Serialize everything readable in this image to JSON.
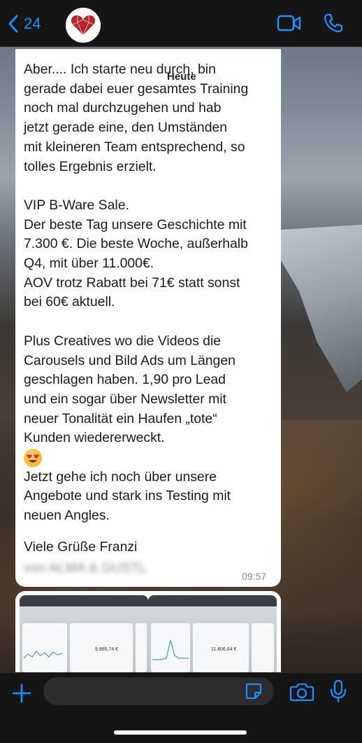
{
  "header": {
    "back_count": "24",
    "icons": {
      "back": "chevron-left-icon",
      "video": "video-camera-icon",
      "phone": "phone-icon",
      "avatar": "heart-logo-avatar"
    },
    "accent": "#1f8fff"
  },
  "date_chip": "Heute",
  "message": {
    "text": "Aber.... Ich starte neu durch, bin\ngerade dabei euer gesamtes Training\nnoch mal durchzugehen und hab\njetzt gerade eine, den Umständen\nmit kleineren Team entsprechend, so\ntolles Ergebnis erzielt.\n\nVIP B-Ware Sale.\nDer beste Tag unsere Geschichte mit\n7.300 €. Die beste Woche, außerhalb\nQ4, mit über 11.000€.\nAOV trotz Rabatt bei 71€ statt sonst\nbei 60€ aktuell.\n\nPlus Creatives wo die Videos die\nCarousels und Bild Ads um Längen\ngeschlagen haben. 1,90 pro Lead\nund ein sogar über Newsletter mit\nneuer Tonalität ein Haufen „tote“\nKunden wiedererweckt.",
    "emoji": "heart-eyes-emoji",
    "text_after": "Jetzt gehe ich noch über unsere\nAngebote und stark ins Testing mit\nneuen Angles.",
    "signature": "Viele Grüße Franzi",
    "blurred_line": "von ALMA & GUSTL",
    "time": "09:57"
  },
  "media": {
    "left_value": "9.895,74 €",
    "right_value": "11.806,64 €"
  },
  "composer": {
    "placeholder": "",
    "icons": {
      "plus": "plus-icon",
      "sticker": "sticker-icon",
      "camera": "camera-icon",
      "mic": "microphone-icon"
    }
  }
}
